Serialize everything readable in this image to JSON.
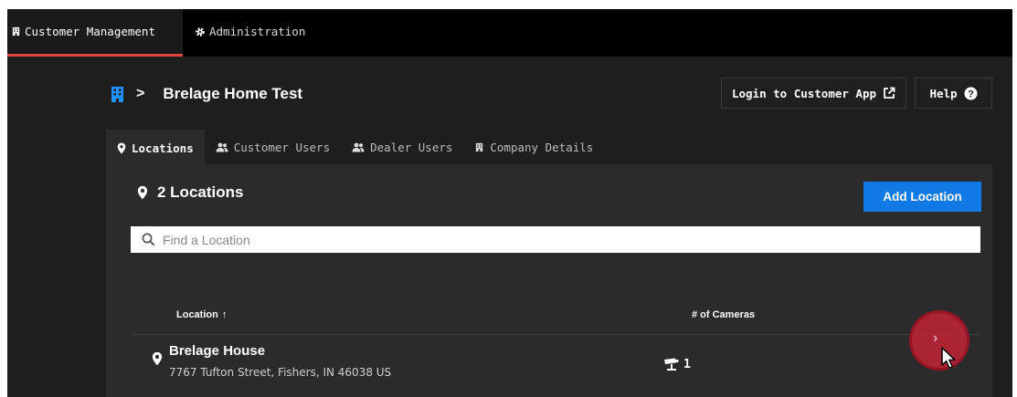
{
  "topnav": {
    "items": [
      {
        "label": "Customer Management",
        "icon": "building-icon",
        "active": true
      },
      {
        "label": "Administration",
        "icon": "gear-icon",
        "active": false
      }
    ],
    "accent_color": "#e0413d"
  },
  "header": {
    "breadcrumb_icon": "building-icon",
    "breadcrumb_separator": ">",
    "title": "Brelage Home Test",
    "login_button_label": "Login to Customer App",
    "login_button_icon": "external-link-icon",
    "help_button_label": "Help",
    "help_button_icon": "help-icon"
  },
  "tabs": [
    {
      "label": "Locations",
      "icon": "map-pin-icon",
      "active": true
    },
    {
      "label": "Customer Users",
      "icon": "users-icon",
      "active": false
    },
    {
      "label": "Dealer Users",
      "icon": "users-icon",
      "active": false
    },
    {
      "label": "Company Details",
      "icon": "building-icon",
      "active": false
    }
  ],
  "locations": {
    "count_label": "2 Locations",
    "add_button_label": "Add Location",
    "add_button_color": "#0f7ae5",
    "search_placeholder": "Find a Location",
    "columns": {
      "location": "Location",
      "location_sort_indicator": "↑",
      "cameras": "# of Cameras"
    },
    "rows": [
      {
        "name": "Brelage House",
        "address": "7767 Tufton Street, Fishers, IN 46038 US",
        "cameras": "1"
      }
    ]
  }
}
